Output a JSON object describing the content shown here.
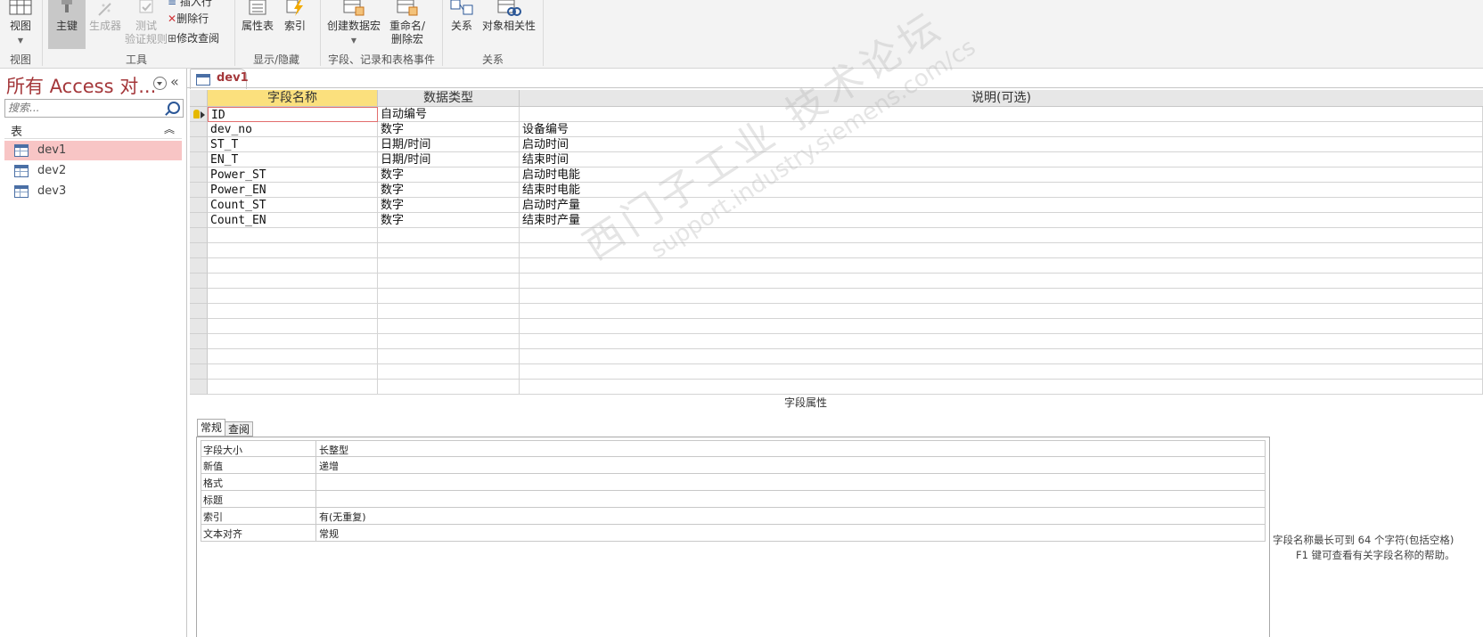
{
  "ribbon": {
    "view": {
      "label": "视图",
      "group": "视图"
    },
    "tools": {
      "primary_key": "主键",
      "builder": "生成器",
      "test_rules_line1": "测试",
      "test_rules_line2": "验证规则",
      "insert_row": "插入行",
      "delete_row": "删除行",
      "modify_lookup": "修改查阅",
      "group": "工具"
    },
    "show_hide": {
      "property_sheet": "属性表",
      "indexes": "索引",
      "group": "显示/隐藏"
    },
    "events": {
      "create_macro": "创建数据宏",
      "rename_macro_line1": "重命名/",
      "rename_macro_line2": "删除宏",
      "group": "字段、记录和表格事件"
    },
    "relationships": {
      "relationships": "关系",
      "object_dependencies": "对象相关性",
      "group": "关系"
    }
  },
  "nav": {
    "title": "所有 Access 对...",
    "search_placeholder": "搜索...",
    "section": "表",
    "items": [
      {
        "label": "dev1",
        "active": true
      },
      {
        "label": "dev2",
        "active": false
      },
      {
        "label": "dev3",
        "active": false
      }
    ]
  },
  "document": {
    "tab": "dev1"
  },
  "grid": {
    "headers": [
      "字段名称",
      "数据类型",
      "说明(可选)"
    ],
    "rows": [
      {
        "name": "ID",
        "type": "自动编号",
        "desc": ""
      },
      {
        "name": "dev_no",
        "type": "数字",
        "desc": "设备编号"
      },
      {
        "name": "ST_T",
        "type": "日期/时间",
        "desc": "启动时间"
      },
      {
        "name": "EN_T",
        "type": "日期/时间",
        "desc": "结束时间"
      },
      {
        "name": "Power_ST",
        "type": "数字",
        "desc": "启动时电能"
      },
      {
        "name": "Power_EN",
        "type": "数字",
        "desc": "结束时电能"
      },
      {
        "name": "Count_ST",
        "type": "数字",
        "desc": "启动时产量"
      },
      {
        "name": "Count_EN",
        "type": "数字",
        "desc": "结束时产量"
      }
    ]
  },
  "properties": {
    "title": "字段属性",
    "tabs": [
      "常规",
      "查阅"
    ],
    "rows": [
      {
        "label": "字段大小",
        "value": "长整型"
      },
      {
        "label": "新值",
        "value": "递增"
      },
      {
        "label": "格式",
        "value": ""
      },
      {
        "label": "标题",
        "value": ""
      },
      {
        "label": "索引",
        "value": "有(无重复)"
      },
      {
        "label": "文本对齐",
        "value": "常规"
      }
    ],
    "help_line1": "字段名称最长可到 64 个字符(包括空格)",
    "help_line2": "F1 键可查看有关字段名称的帮助。"
  },
  "watermark": {
    "line1": "西门子工业  技术论坛",
    "line2": "support.industry.siemens.com/cs"
  }
}
